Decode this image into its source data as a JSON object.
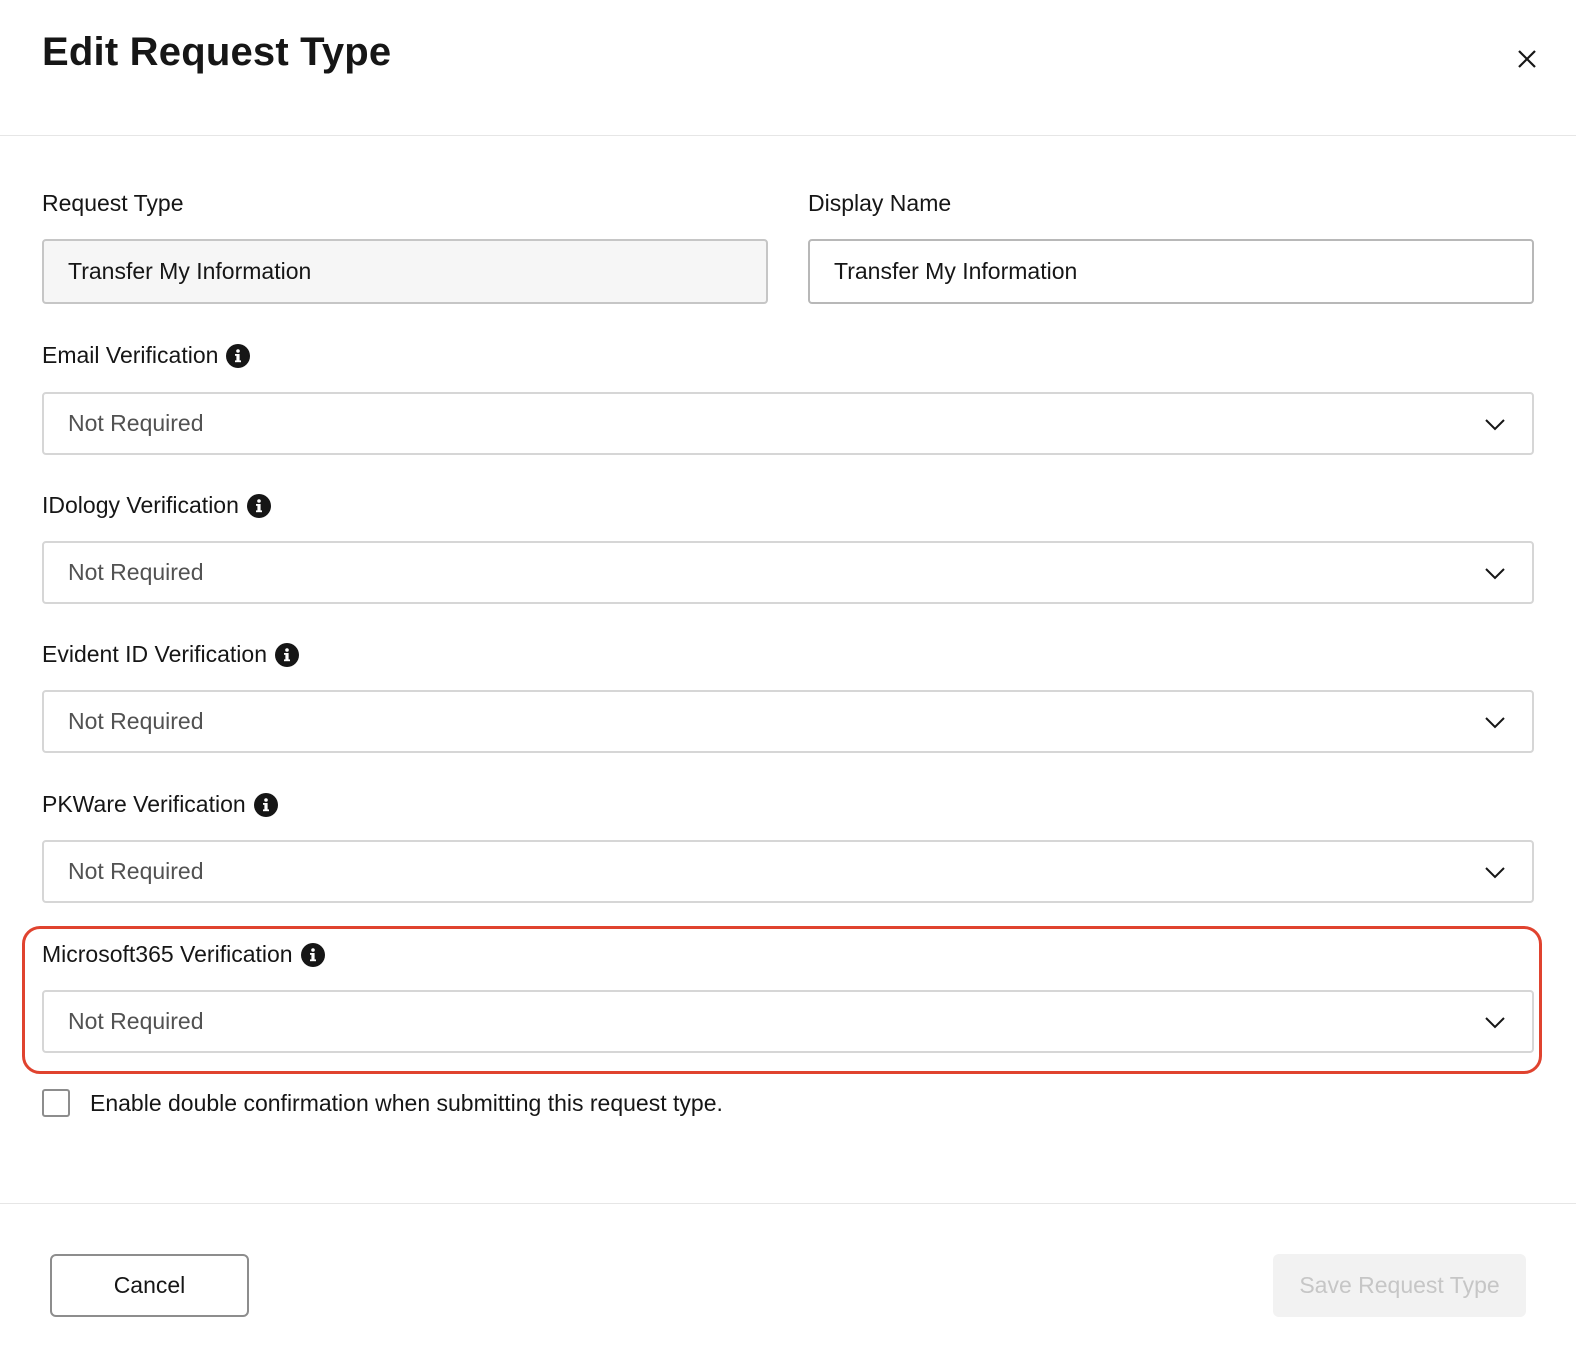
{
  "header": {
    "title": "Edit Request Type",
    "close_icon": "close-icon"
  },
  "form": {
    "request_type": {
      "label": "Request Type",
      "value": "Transfer My Information"
    },
    "display_name": {
      "label": "Display Name",
      "value": "Transfer My Information"
    },
    "verifications": [
      {
        "label": "Email Verification",
        "value": "Not Required"
      },
      {
        "label": "IDology Verification",
        "value": "Not Required"
      },
      {
        "label": "Evident ID Verification",
        "value": "Not Required"
      },
      {
        "label": "PKWare Verification",
        "value": "Not Required"
      },
      {
        "label": "Microsoft365 Verification",
        "value": "Not Required"
      }
    ],
    "double_confirmation": {
      "label": "Enable double confirmation when submitting this request type.",
      "checked": false
    }
  },
  "footer": {
    "cancel_label": "Cancel",
    "save_label": "Save Request Type"
  },
  "colors": {
    "highlight": "#e0432f",
    "disabled_button_bg": "#f2f2f2",
    "disabled_button_text": "#c6c6c6"
  }
}
